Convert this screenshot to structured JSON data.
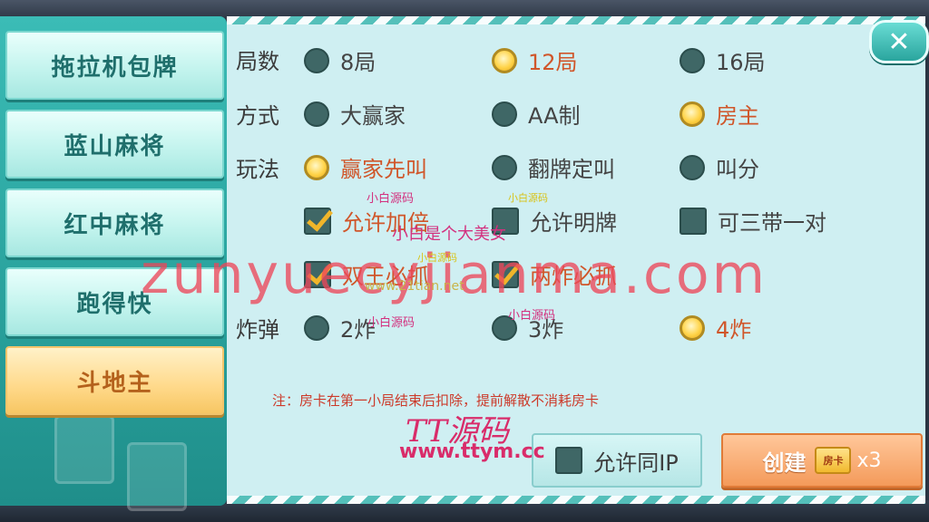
{
  "sidebar": {
    "items": [
      {
        "label": "拖拉机包牌",
        "active": false
      },
      {
        "label": "蓝山麻将",
        "active": false
      },
      {
        "label": "红中麻将",
        "active": false
      },
      {
        "label": "跑得快",
        "active": false
      },
      {
        "label": "斗地主",
        "active": true
      }
    ]
  },
  "close_label": "✕",
  "rows": {
    "rounds": {
      "label": "局数",
      "options": [
        "8局",
        "12局",
        "16局"
      ],
      "selected": "12局"
    },
    "mode": {
      "label": "方式",
      "options": [
        "大赢家",
        "AA制",
        "房主"
      ],
      "selected": "房主"
    },
    "play": {
      "label": "玩法",
      "options": [
        "赢家先叫",
        "翻牌定叫",
        "叫分"
      ],
      "selected": "赢家先叫"
    },
    "rules1": {
      "options": [
        "允许加倍",
        "允许明牌",
        "可三带一对"
      ],
      "checked": [
        true,
        false,
        false
      ]
    },
    "rules2": {
      "options": [
        "双王必抓",
        "两炸必抓"
      ],
      "checked": [
        true,
        true
      ]
    },
    "bomb": {
      "label": "炸弹",
      "options": [
        "2炸",
        "3炸",
        "4炸"
      ],
      "selected": "4炸"
    }
  },
  "note": "注：房卡在第一小局结束后扣除，提前解散不消耗房卡",
  "allow_same_ip": {
    "label": "允许同IP",
    "checked": false
  },
  "create": {
    "label": "创建",
    "card_icon_text": "房卡",
    "cost": "x3"
  },
  "watermarks": {
    "big": "zunyuecyjianma.com",
    "small_1": "小白源码",
    "small_2": "小白源码",
    "small_3": "小白是个大美女",
    "small_4": "小白源码",
    "small_5": "www.21tian.net",
    "small_6": "小白源码",
    "small_7": "小白源码",
    "brand": "TT源码",
    "brand_url": "www.ttym.cc"
  }
}
